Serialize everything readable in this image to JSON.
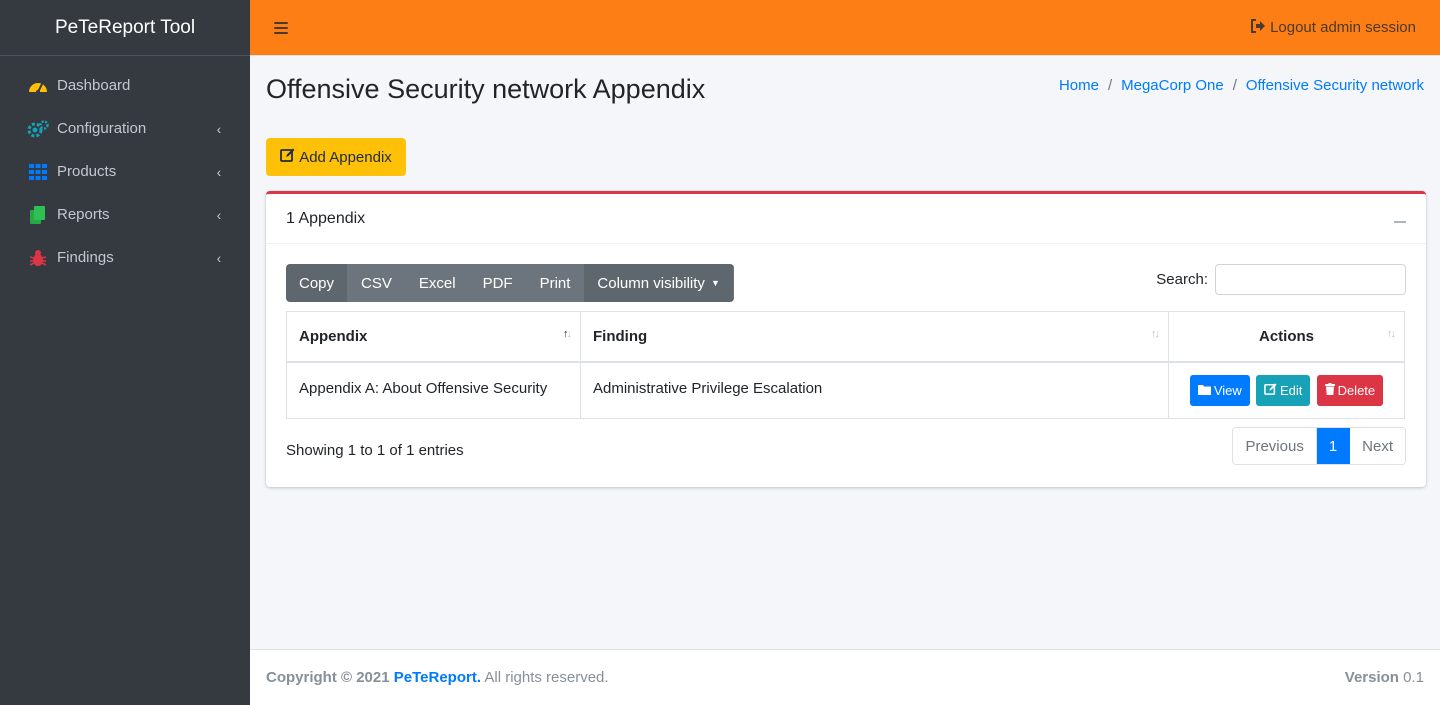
{
  "brand": "PeTeReport Tool",
  "sidebar": {
    "items": [
      {
        "label": "Dashboard",
        "icon": "dashboard-gauge-icon",
        "color": "#ffc107"
      },
      {
        "label": "Configuration",
        "icon": "cogs-icon",
        "color": "#17a2b8"
      },
      {
        "label": "Products",
        "icon": "grid-icon",
        "color": "#007bff"
      },
      {
        "label": "Reports",
        "icon": "copy-docs-icon",
        "color": "#28a745"
      },
      {
        "label": "Findings",
        "icon": "bug-icon",
        "color": "#dc3545"
      }
    ]
  },
  "navbar": {
    "logout_label": "Logout admin session",
    "color": "#fd7e14"
  },
  "page": {
    "title": "Offensive Security network Appendix",
    "breadcrumb": [
      "Home",
      "MegaCorp One",
      "Offensive Security network"
    ],
    "add_button": "Add Appendix"
  },
  "card": {
    "title": "1 Appendix",
    "toolbar": [
      "Copy",
      "CSV",
      "Excel",
      "PDF",
      "Print",
      "Column visibility"
    ],
    "search_label": "Search:",
    "search_value": "",
    "columns": [
      "Appendix",
      "Finding",
      "Actions"
    ],
    "rows": [
      {
        "appendix": "Appendix A: About Offensive Security",
        "finding": "Administrative Privilege Escalation"
      }
    ],
    "actions": {
      "view": "View",
      "edit": "Edit",
      "delete": "Delete"
    },
    "info": "Showing 1 to 1 of 1 entries",
    "pager": {
      "prev": "Previous",
      "current": "1",
      "next": "Next"
    }
  },
  "footer": {
    "copyright_prefix": "Copyright © 2021",
    "brand": "PeTeReport.",
    "suffix": "All rights reserved.",
    "version_label": "Version",
    "version": "0.1"
  }
}
